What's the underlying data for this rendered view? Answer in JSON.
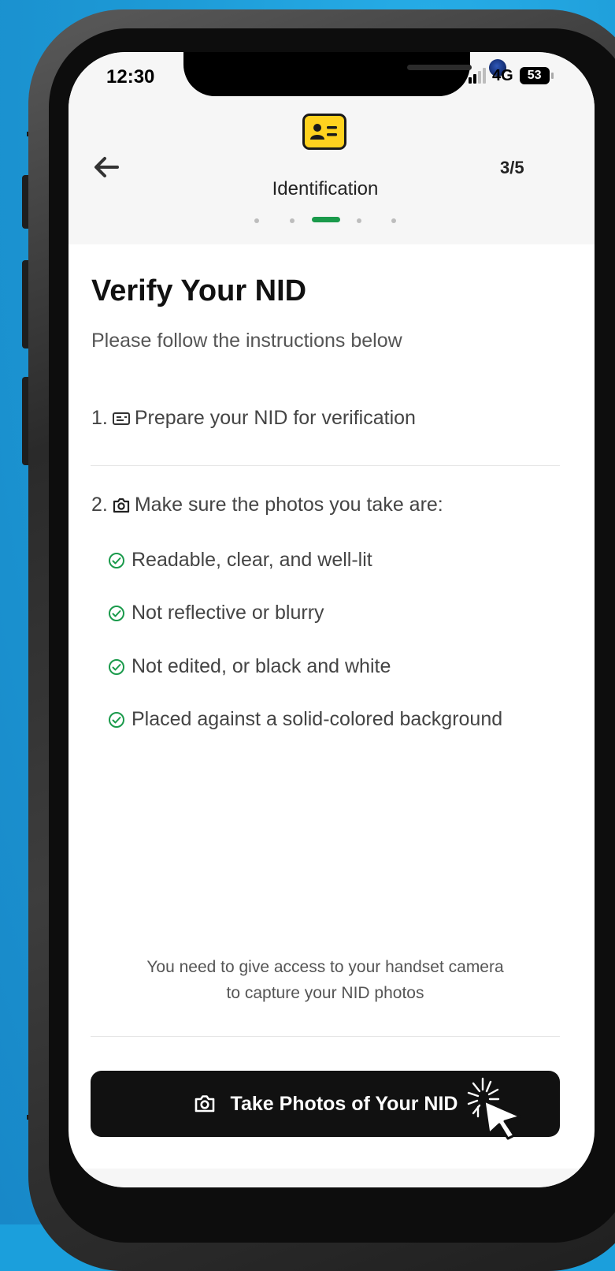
{
  "status_bar": {
    "time": "12:30",
    "network": "4G",
    "battery": "53"
  },
  "header": {
    "title": "Identification",
    "step_counter": "3/5",
    "step_total": 5,
    "step_current": 3,
    "icons": {
      "back": "arrow-left-icon",
      "badge": "id-card-icon"
    }
  },
  "main": {
    "title": "Verify Your NID",
    "subtitle": "Please follow the instructions below",
    "steps": [
      {
        "number": "1.",
        "icon": "id-card-icon",
        "text": "Prepare your NID for verification"
      },
      {
        "number": "2.",
        "icon": "camera-icon",
        "text": "Make sure the photos you take are:"
      }
    ],
    "checklist": [
      "Readable, clear, and well-lit",
      "Not reflective or blurry",
      "Not edited, or black and white",
      "Placed against a solid-colored background"
    ],
    "note": "You need to give access to your handset camera to capture your NID photos"
  },
  "cta": {
    "label": "Take Photos of Your NID",
    "icon": "camera-icon"
  },
  "colors": {
    "background": "#1b9fdc",
    "accent": "#1a9a4b",
    "badge": "#ffd21f",
    "button": "#111111"
  }
}
